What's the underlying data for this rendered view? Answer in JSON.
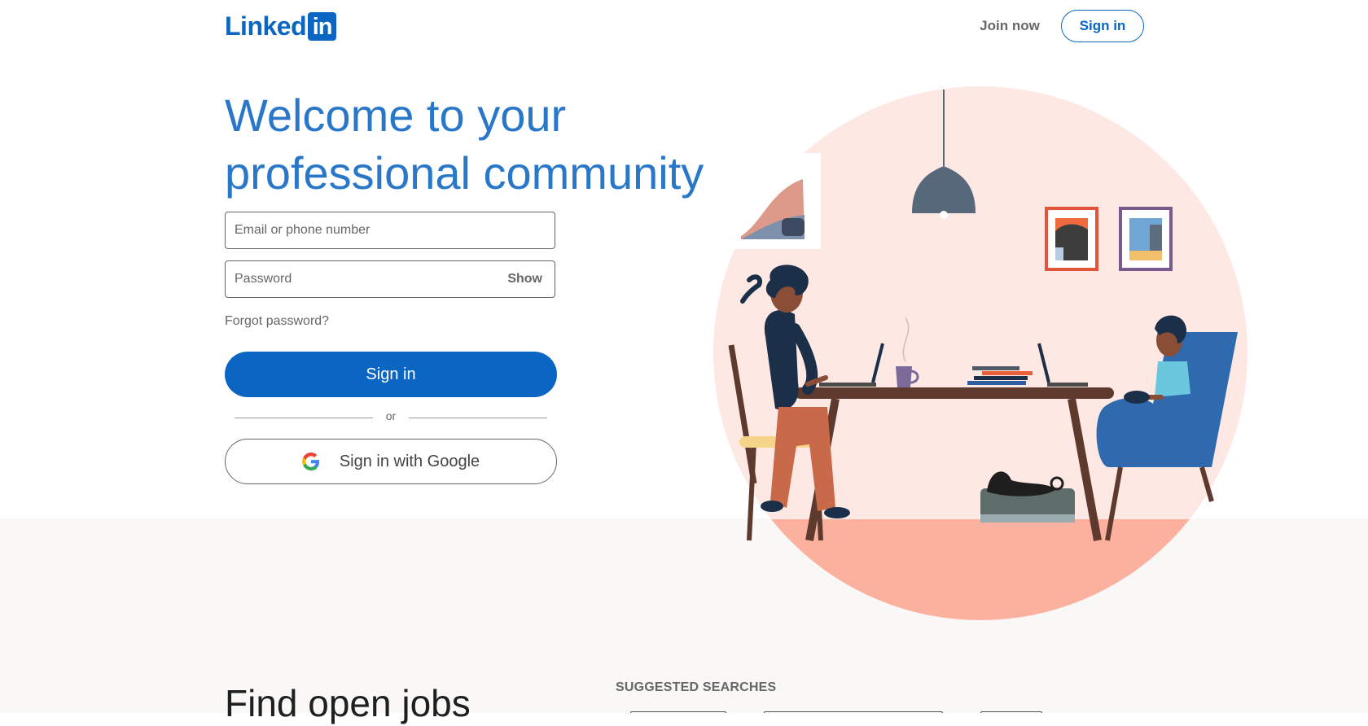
{
  "header": {
    "logo_text": "Linked",
    "logo_box_text": "in",
    "join_now_label": "Join now",
    "sign_in_label": "Sign in"
  },
  "hero": {
    "title": "Welcome to your professional community",
    "email_placeholder": "Email or phone number",
    "password_placeholder": "Password",
    "show_label": "Show",
    "forgot_password_label": "Forgot password?",
    "sign_in_button_label": "Sign in",
    "divider_text": "or",
    "google_button_label": "Sign in with Google",
    "google_icon": "google-g-icon",
    "illustration": "people-working-at-table-illustration"
  },
  "jobs": {
    "title": "Find open jobs",
    "suggested_searches_label": "SUGGESTED SEARCHES"
  },
  "colors": {
    "brand_blue": "#0a66c2",
    "title_blue": "#2977c9",
    "hero_circle": "#fde8e4",
    "floor": "#fcb09e",
    "bottom_band": "#f9f8f6"
  }
}
